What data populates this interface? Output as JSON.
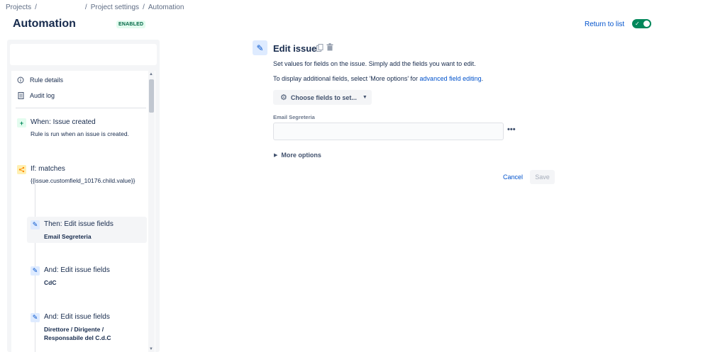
{
  "breadcrumb": {
    "projects": "Projects",
    "sep": "/",
    "project_settings": "Project settings",
    "automation": "Automation"
  },
  "header": {
    "title": "Automation",
    "badge": "ENABLED",
    "return_label": "Return to list",
    "toggle_on": true
  },
  "sidebar": {
    "rule_details": "Rule details",
    "audit_log": "Audit log",
    "steps": [
      {
        "kind": "trigger",
        "title": "When: Issue created",
        "sub": "Rule is run when an issue is created."
      },
      {
        "kind": "condition",
        "title": "If: matches",
        "sub": "{{issue.customfield_10176.child.value}}"
      },
      {
        "kind": "action",
        "title": "Then: Edit issue fields",
        "sub": "Email Segreteria",
        "selected": true
      },
      {
        "kind": "action",
        "title": "And: Edit issue fields",
        "sub": "CdC"
      },
      {
        "kind": "action",
        "title": "And: Edit issue fields",
        "sub": "Direttore / Dirigente / Responsabile del C.d.C"
      }
    ]
  },
  "editor": {
    "title": "Edit issue",
    "desc1": "Set values for fields on the issue. Simply add the fields you want to edit.",
    "desc2_prefix": "To display additional fields, select 'More options' for ",
    "desc2_link": "advanced field editing",
    "desc2_suffix": ".",
    "choose_fields": "Choose fields to set...",
    "field_label": "Email Segreteria",
    "field_value": "",
    "more_options": "More options",
    "cancel": "Cancel",
    "save": "Save"
  },
  "colors": {
    "accent": "#0052cc",
    "enabled_green": "#00875a",
    "badge_bg": "#e3fcef"
  }
}
